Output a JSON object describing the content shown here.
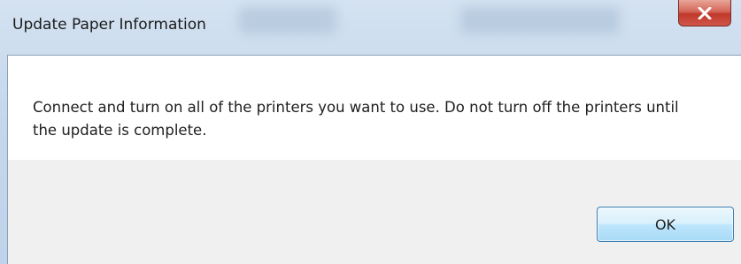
{
  "window": {
    "title": "Update Paper Information",
    "close_icon": "close-icon"
  },
  "dialog": {
    "message": "Connect and turn on all of the printers you want to use. Do not turn off the printers until the update is complete."
  },
  "buttons": {
    "ok_label": "OK"
  },
  "colors": {
    "titlebar": "#c5d7ec",
    "content_bg": "#ffffff",
    "button_area_bg": "#f0f0f0",
    "close_button": "#c0392b",
    "ok_border": "#3c7fb1"
  }
}
